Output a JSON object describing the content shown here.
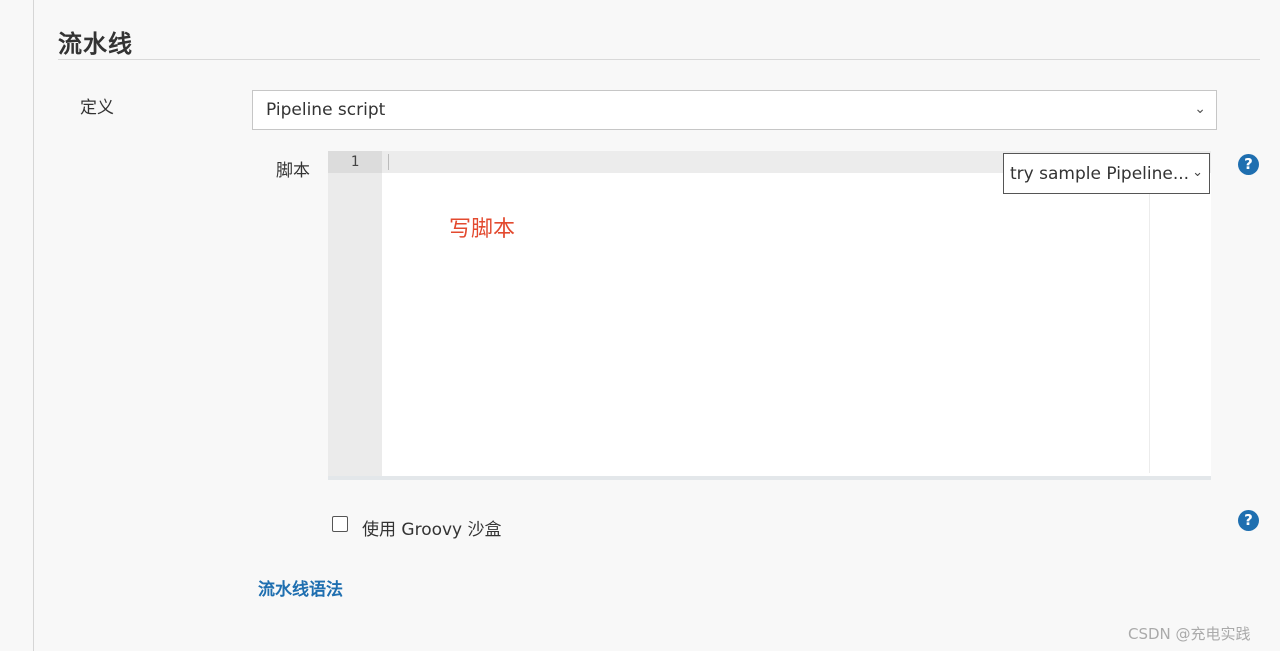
{
  "section": {
    "title": "流水线"
  },
  "definition": {
    "label": "定义",
    "selected": "Pipeline script"
  },
  "script": {
    "label": "脚本",
    "line_number": "1",
    "placeholder": "写脚本",
    "sample_select": "try sample Pipeline..."
  },
  "help": {
    "symbol": "?"
  },
  "sandbox": {
    "label": "使用 Groovy 沙盒",
    "checked": false
  },
  "links": {
    "pipeline_syntax": "流水线语法"
  },
  "watermark": "CSDN @充电实践",
  "colors": {
    "link": "#1f6fb0",
    "help_icon": "#1f6fb0",
    "placeholder_text": "#e34a2f"
  }
}
